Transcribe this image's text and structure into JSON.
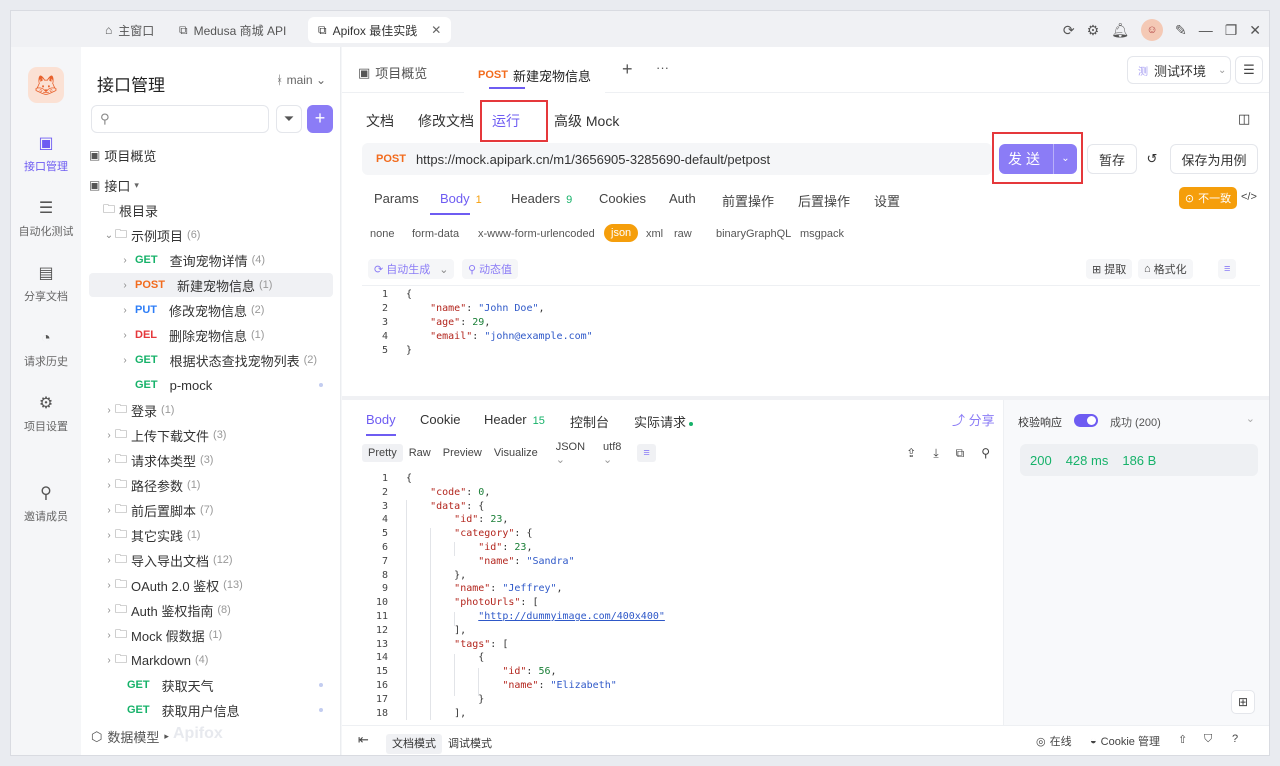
{
  "window": {
    "tabs": [
      {
        "label": "主窗口",
        "icon": "home-icon"
      },
      {
        "label": "Medusa 商城 API",
        "icon": "external-link-icon"
      },
      {
        "label": "Apifox 最佳实践",
        "icon": "external-link-icon"
      }
    ],
    "close": "✕"
  },
  "rail": {
    "items": [
      {
        "label": "接口管理"
      },
      {
        "label": "自动化测试"
      },
      {
        "label": "分享文档"
      },
      {
        "label": "请求历史"
      },
      {
        "label": "项目设置"
      },
      {
        "label": "邀请成员"
      }
    ]
  },
  "sidebar": {
    "title": "接口管理",
    "branch": "main",
    "overview": "项目概览",
    "interfaces": "接口",
    "root": "根目录",
    "tree": [
      {
        "kind": "folder",
        "label": "示例项目",
        "count": "(6)",
        "open": true
      },
      {
        "kind": "api",
        "method": "GET",
        "label": "查询宠物详情",
        "count": "(4)"
      },
      {
        "kind": "api",
        "method": "POST",
        "label": "新建宠物信息",
        "count": "(1)",
        "selected": true
      },
      {
        "kind": "api",
        "method": "PUT",
        "label": "修改宠物信息",
        "count": "(2)"
      },
      {
        "kind": "api",
        "method": "DEL",
        "label": "删除宠物信息",
        "count": "(1)"
      },
      {
        "kind": "api",
        "method": "GET",
        "label": "根据状态查找宠物列表",
        "count": "(2)"
      },
      {
        "kind": "api",
        "method": "GET",
        "label": "p-mock",
        "count": ""
      },
      {
        "kind": "folder",
        "label": "登录",
        "count": "(1)"
      },
      {
        "kind": "folder",
        "label": "上传下载文件",
        "count": "(3)"
      },
      {
        "kind": "folder",
        "label": "请求体类型",
        "count": "(3)"
      },
      {
        "kind": "folder",
        "label": "路径参数",
        "count": "(1)"
      },
      {
        "kind": "folder",
        "label": "前后置脚本",
        "count": "(7)"
      },
      {
        "kind": "folder",
        "label": "其它实践",
        "count": "(1)"
      },
      {
        "kind": "folder",
        "label": "导入导出文档",
        "count": "(12)"
      },
      {
        "kind": "folder",
        "label": "OAuth 2.0 鉴权",
        "count": "(13)"
      },
      {
        "kind": "folder",
        "label": "Auth 鉴权指南",
        "count": "(8)"
      },
      {
        "kind": "folder",
        "label": "Mock 假数据",
        "count": "(1)"
      },
      {
        "kind": "folder",
        "label": "Markdown",
        "count": "(4)"
      },
      {
        "kind": "api",
        "method": "GET",
        "label": "获取天气",
        "count": ""
      },
      {
        "kind": "api",
        "method": "GET",
        "label": "获取用户信息",
        "count": ""
      }
    ],
    "footer": "数据模型",
    "watermark": "Apifox"
  },
  "tabs": {
    "overview": "项目概览",
    "method": "POST",
    "request": "新建宠物信息",
    "add": "+",
    "more": "···",
    "env": "测试环境",
    "env_badge": "测"
  },
  "subtabs": [
    "文档",
    "修改文档",
    "运行",
    "高级 Mock"
  ],
  "request": {
    "method": "POST",
    "url": "https://mock.apipark.cn/m1/3656905-3285690-default/petpost",
    "send": "发送",
    "save_temp": "暂存",
    "save_case": "保存为用例"
  },
  "req_tabs": [
    {
      "label": "Params",
      "count": ""
    },
    {
      "label": "Body",
      "count": "1"
    },
    {
      "label": "Headers",
      "count": "9"
    },
    {
      "label": "Cookies",
      "count": ""
    },
    {
      "label": "Auth",
      "count": ""
    },
    {
      "label": "前置操作",
      "count": ""
    },
    {
      "label": "后置操作",
      "count": ""
    },
    {
      "label": "设置",
      "count": ""
    }
  ],
  "mismatch": "不一致",
  "body_types": [
    "none",
    "form-data",
    "x-www-form-urlencoded",
    "json",
    "xml",
    "raw",
    "binary",
    "GraphQL",
    "msgpack"
  ],
  "body_tools": {
    "auto": "自动生成",
    "dynamic": "动态值",
    "extract": "提取",
    "format": "格式化"
  },
  "request_body": [
    "{",
    "    \"name\": \"John Doe\",",
    "    \"age\": 29,",
    "    \"email\": \"john@example.com\"",
    "}"
  ],
  "response": {
    "tabs": [
      {
        "label": "Body",
        "count": ""
      },
      {
        "label": "Cookie",
        "count": ""
      },
      {
        "label": "Header",
        "count": "15"
      },
      {
        "label": "控制台",
        "count": ""
      },
      {
        "label": "实际请求",
        "count": ""
      }
    ],
    "share": "分享",
    "formats": [
      "Pretty",
      "Raw",
      "Preview",
      "Visualize",
      "JSON",
      "utf8"
    ],
    "lines": [
      "{",
      "    \"code\": 0,",
      "    \"data\": {",
      "        \"id\": 23,",
      "        \"category\": {",
      "            \"id\": 23,",
      "            \"name\": \"Sandra\"",
      "        },",
      "        \"name\": \"Jeffrey\",",
      "        \"photoUrls\": [",
      "            \"http://dummyimage.com/400x400\"",
      "        ],",
      "        \"tags\": [",
      "            {",
      "                \"id\": 56,",
      "                \"name\": \"Elizabeth\"",
      "            }",
      "        ],"
    ]
  },
  "validate": {
    "label": "校验响应",
    "status": "成功 (200)"
  },
  "stats": {
    "code": "200",
    "time": "428 ms",
    "size": "186 B"
  },
  "bottom": {
    "doc_mode": "文档模式",
    "debug_mode": "调试模式",
    "online": "在线",
    "cookie": "Cookie 管理"
  },
  "colors": {
    "accent": "#8b7cf6",
    "get": "#17b26a",
    "post": "#f26b1d",
    "put": "#2e7ef7",
    "del": "#e5383b",
    "badge": "#f59e0b",
    "highlight": "#e5383b"
  }
}
